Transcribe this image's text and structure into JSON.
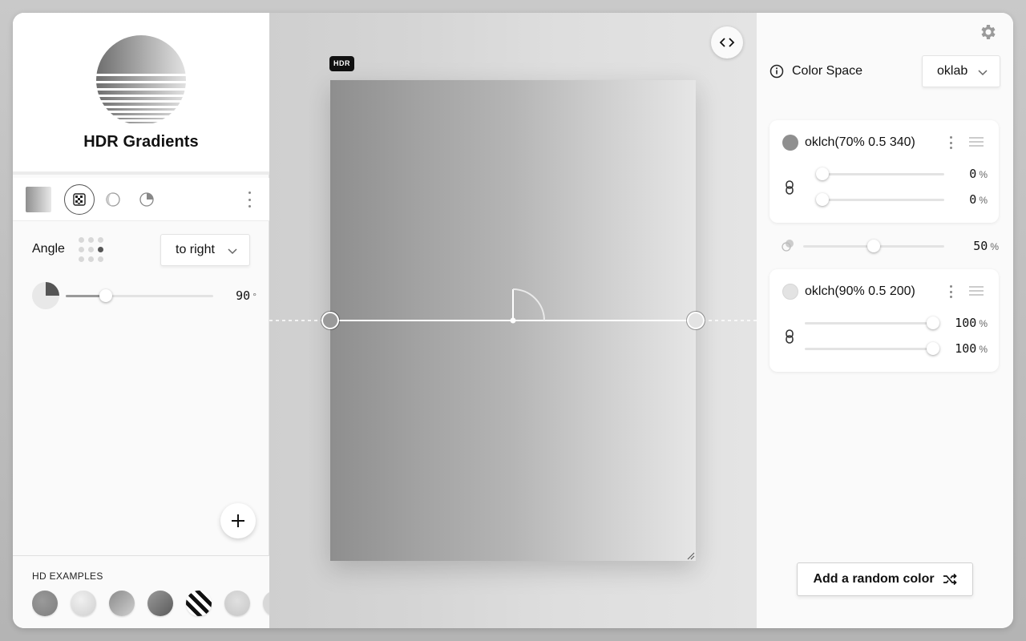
{
  "app": {
    "title": "HDR Gradients"
  },
  "angle": {
    "label": "Angle",
    "direction": "to right",
    "value": "90",
    "unit": "°",
    "fraction": 0.25
  },
  "canvas": {
    "badge": "HDR"
  },
  "examples": {
    "title": "HD EXAMPLES"
  },
  "color_space": {
    "label": "Color Space",
    "value": "oklab"
  },
  "stops": [
    {
      "name": "oklch(70% 0.5 340)",
      "swatch": "#8f8f8f",
      "start": {
        "value": "0",
        "unit": "%",
        "fraction": 0.0
      },
      "end": {
        "value": "0",
        "unit": "%",
        "fraction": 0.0
      }
    },
    {
      "name": "oklch(90% 0.5 200)",
      "swatch": "#e3e3e3",
      "start": {
        "value": "100",
        "unit": "%",
        "fraction": 1.0
      },
      "end": {
        "value": "100",
        "unit": "%",
        "fraction": 1.0
      }
    }
  ],
  "transition": {
    "value": "50",
    "unit": "%",
    "fraction": 0.5
  },
  "actions": {
    "random_color": "Add a random color"
  }
}
